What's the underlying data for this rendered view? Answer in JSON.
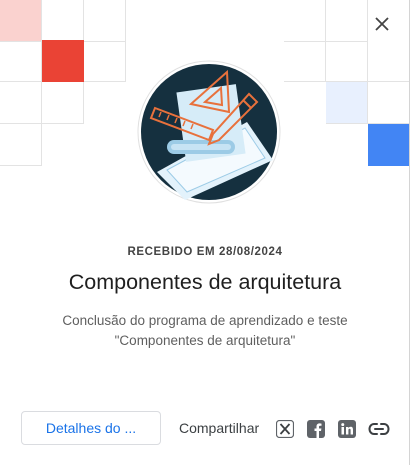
{
  "dialog": {
    "close_icon": "close-icon",
    "received": "RECEBIDO EM 28/08/2024",
    "title": "Componentes de arquitetura",
    "description_line1": "Conclusão do programa de aprendizado e teste",
    "description_line2": "\"Componentes de arquitetura\"",
    "details_button": "Detalhes do ...",
    "share_label": "Compartilhar",
    "share_icons": [
      "x-icon",
      "facebook-icon",
      "linkedin-icon",
      "link-icon"
    ]
  },
  "colors": {
    "accent": "#1a73e8",
    "red_tile": "#ea4335",
    "pink_tile": "#fad2cf",
    "blue_tile": "#4285f4",
    "light_blue_tile": "#e8f0fe",
    "badge_bg": "#15303f",
    "badge_accent": "#e8713c"
  }
}
